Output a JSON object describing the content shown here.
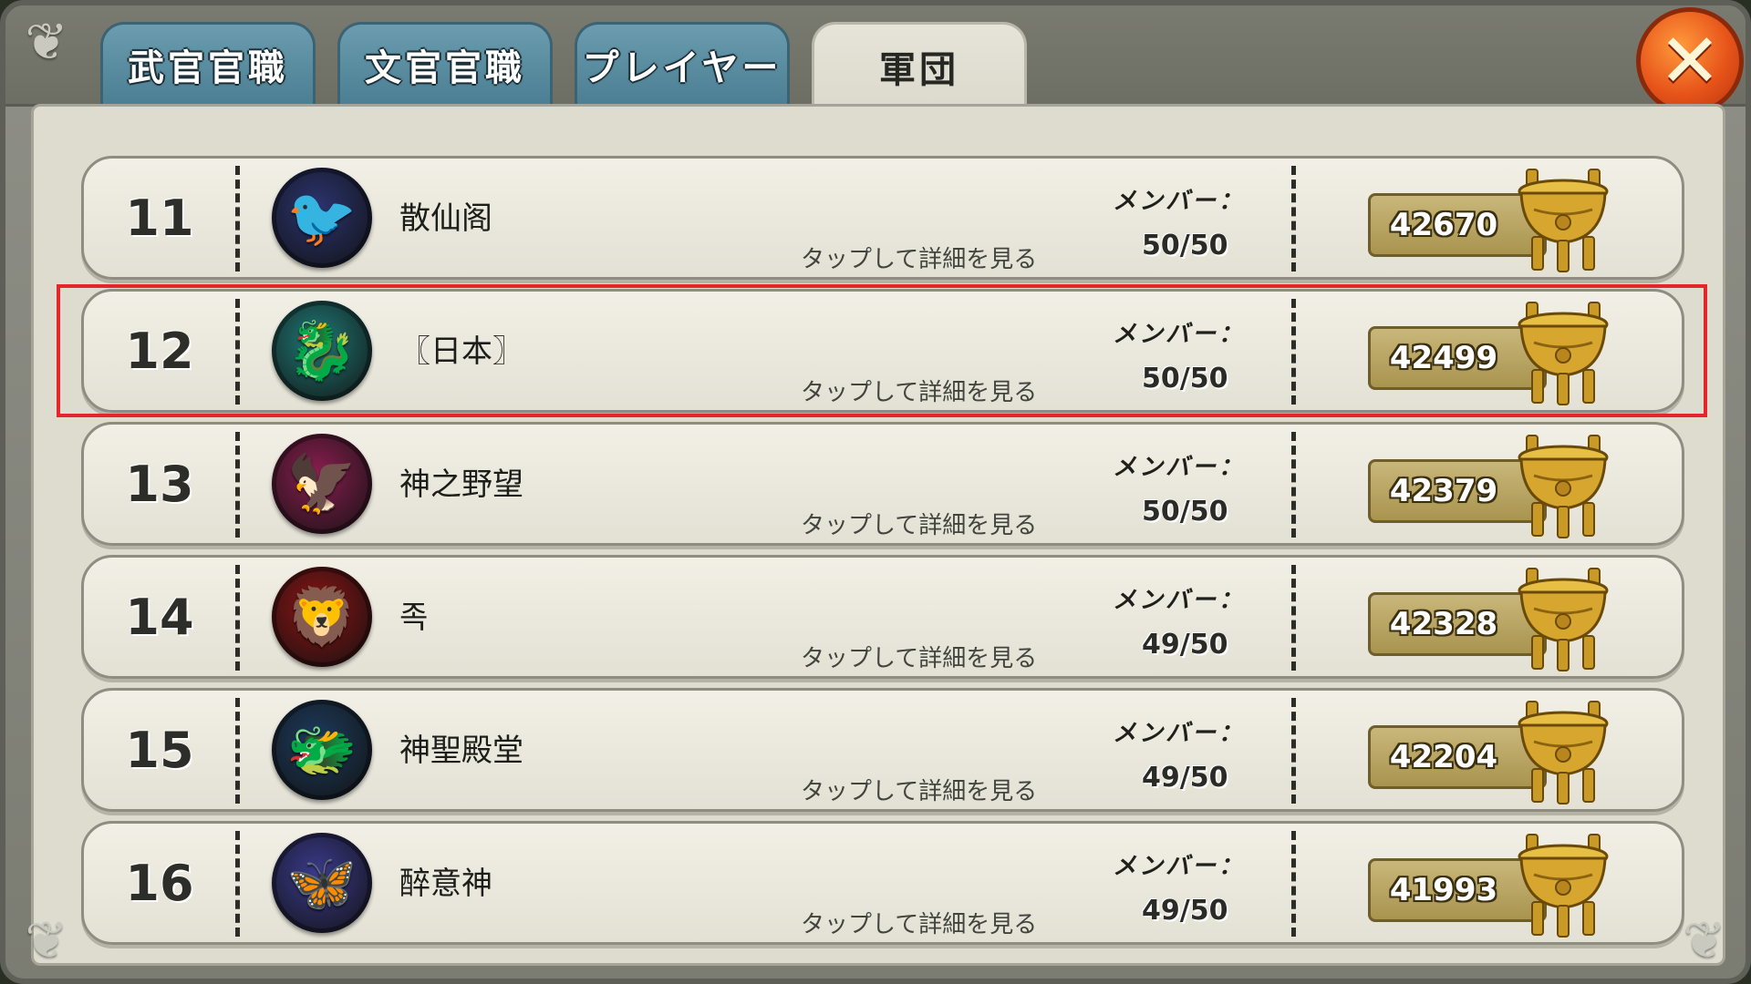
{
  "tabs": [
    {
      "label": "武官官職",
      "active": false
    },
    {
      "label": "文官官職",
      "active": false
    },
    {
      "label": "プレイヤー",
      "active": false
    },
    {
      "label": "軍団",
      "active": true
    }
  ],
  "close_button": {
    "icon": "close-x-icon",
    "symbol": "✕"
  },
  "list": {
    "tap_hint": "タップして詳細を見る",
    "member_label": "メンバー：",
    "rows": [
      {
        "rank": "11",
        "name": "散仙阁",
        "members": "50/50",
        "score": "42670",
        "emblem_icon": "phoenix-emblem-icon",
        "emblem_glyph": "🐦",
        "emblem_color": "#2b3470",
        "highlighted": false
      },
      {
        "rank": "12",
        "name": "〖日本〗",
        "members": "50/50",
        "score": "42499",
        "emblem_icon": "dragon-emblem-icon",
        "emblem_glyph": "🐉",
        "emblem_color": "#1f7a76",
        "highlighted": true
      },
      {
        "rank": "13",
        "name": "神之野望",
        "members": "50/50",
        "score": "42379",
        "emblem_icon": "golden-phoenix-emblem-icon",
        "emblem_glyph": "🦅",
        "emblem_color": "#8a1e4f",
        "highlighted": false
      },
      {
        "rank": "14",
        "name": "족",
        "members": "49/50",
        "score": "42328",
        "emblem_icon": "lion-knocker-emblem-icon",
        "emblem_glyph": "🦁",
        "emblem_color": "#8c1414",
        "highlighted": false
      },
      {
        "rank": "15",
        "name": "神聖殿堂",
        "members": "49/50",
        "score": "42204",
        "emblem_icon": "golden-dragon-emblem-icon",
        "emblem_glyph": "🐲",
        "emblem_color": "#1d3b5c",
        "highlighted": false
      },
      {
        "rank": "16",
        "name": "醉意神",
        "members": "49/50",
        "score": "41993",
        "emblem_icon": "butterfly-emblem-icon",
        "emblem_glyph": "🦋",
        "emblem_color": "#3a3a8c",
        "highlighted": false
      }
    ]
  },
  "colors": {
    "highlight_border": "#e4262b",
    "tab_inactive": "#5b8ea2",
    "tab_active": "#e2e0d4",
    "score_box": "#b8a562"
  }
}
